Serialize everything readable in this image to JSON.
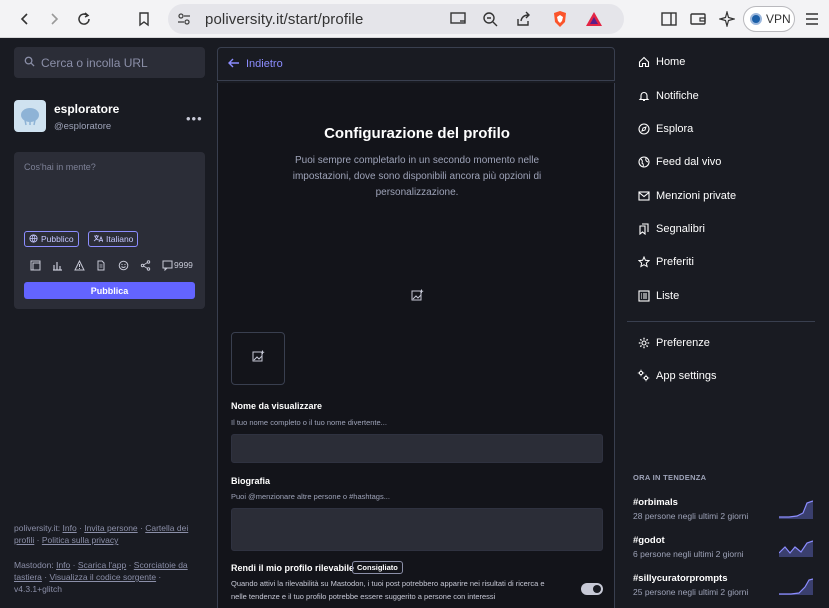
{
  "browser": {
    "url": "poliversity.it/start/profile",
    "vpn_label": "VPN"
  },
  "sidebar": {
    "search_placeholder": "Cerca o incolla URL",
    "account": {
      "display_name": "esploratore",
      "handle": "@esploratore"
    },
    "compose": {
      "placeholder": "Cos'hai in mente?",
      "visibility_label": "Pubblico",
      "language_label": "Italiano",
      "char_count": "9999",
      "publish_label": "Pubblica"
    },
    "footer1": {
      "site": "poliversity.it",
      "links": [
        "Info",
        "Invita persone",
        "Cartella dei profili",
        "Politica sulla privacy"
      ]
    },
    "footer2": {
      "prefix": "Mastodon",
      "links": [
        "Info",
        "Scarica l'app",
        "Scorciatoie da tastiera",
        "Visualizza il codice sorgente"
      ],
      "version": "v4.3.1+glitch"
    }
  },
  "main": {
    "back_label": "Indietro",
    "title": "Configurazione del profilo",
    "subtitle": "Puoi sempre completarlo in un secondo momento nelle impostazioni, dove sono disponibili ancora più opzioni di personalizzazione.",
    "display_name_label": "Nome da visualizzare",
    "display_name_hint": "Il tuo nome completo o il tuo nome divertente...",
    "display_name_value": "",
    "bio_label": "Biografia",
    "bio_hint": "Puoi @menzionare altre persone o #hashtags...",
    "bio_value": "",
    "discoverable_label": "Rendi il mio profilo rilevabile",
    "discoverable_badge": "Consigliato",
    "discoverable_text": "Quando attivi la rilevabilità su Mastodon, i tuoi post potrebbero apparire nei risultati di ricerca e nelle tendenze e il tuo profilo potrebbe essere suggerito a persone con interessi"
  },
  "nav": {
    "items": [
      {
        "label": "Home",
        "icon": "home-icon"
      },
      {
        "label": "Notifiche",
        "icon": "bell-icon"
      },
      {
        "label": "Esplora",
        "icon": "compass-icon"
      },
      {
        "label": "Feed dal vivo",
        "icon": "globe-icon"
      },
      {
        "label": "Menzioni private",
        "icon": "mail-icon"
      },
      {
        "label": "Segnalibri",
        "icon": "bookmarks-icon"
      },
      {
        "label": "Preferiti",
        "icon": "star-icon"
      },
      {
        "label": "Liste",
        "icon": "list-icon"
      }
    ],
    "settings": [
      {
        "label": "Preferenze",
        "icon": "gear-icon"
      },
      {
        "label": "App settings",
        "icon": "gears-icon"
      }
    ],
    "trending_heading": "ORA IN TENDENZA",
    "trends": [
      {
        "tag": "#orbimals",
        "meta": "28 persone negli ultimi 2 giorni"
      },
      {
        "tag": "#godot",
        "meta": "6 persone negli ultimi 2 giorni"
      },
      {
        "tag": "#sillycuratorprompts",
        "meta": "25 persone negli ultimi 2 giorni"
      }
    ]
  },
  "colors": {
    "accent": "#6364ff",
    "bg": "#191b22",
    "panel": "#13141a",
    "field": "#2b2d37"
  }
}
